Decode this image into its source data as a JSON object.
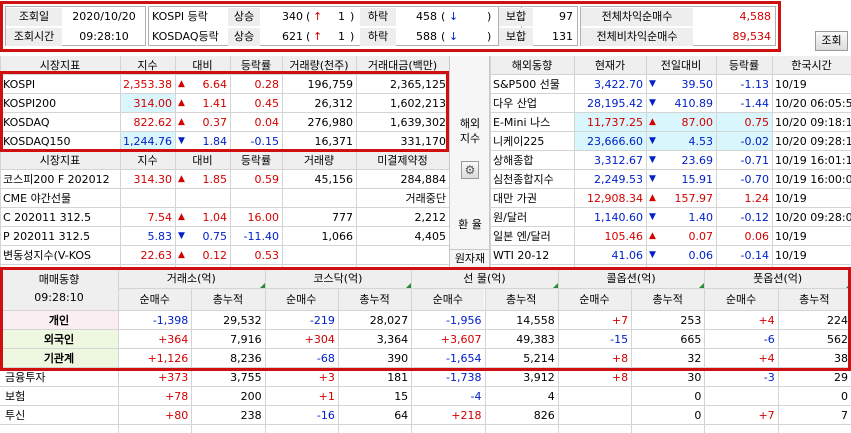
{
  "top": {
    "date_label": "조회일",
    "date_value": "2020/10/20",
    "time_label": "조회시간",
    "time_value": "09:28:10",
    "kospi_label": "KOSPI 등락",
    "kosdaq_label": "KOSDAQ등락",
    "rise_label": "상승",
    "fall_label": "하락",
    "flat_label": "보합",
    "kospi_rise": "340",
    "kospi_limit_up": "1",
    "kospi_fall": "458",
    "kospi_limit_down": "",
    "kospi_flat": "97",
    "kosdaq_rise": "621",
    "kosdaq_limit_up": "1",
    "kosdaq_fall": "588",
    "kosdaq_limit_down": "",
    "kosdaq_flat": "131",
    "arb_label": "전체차익순매수",
    "arb_value": "4,588",
    "nonarb_label": "전체비차익순매수",
    "nonarb_value": "89,534",
    "up_arrow": "↑",
    "down_arrow": "↓",
    "lookup_button": "조회"
  },
  "market": {
    "headers": [
      "시장지표",
      "지수",
      "대비",
      "등락률",
      "거래량(천주)",
      "거래대금(백만)"
    ],
    "rows": [
      {
        "name": "KOSPI",
        "index": "2,353.38",
        "dir": "up",
        "change": "6.64",
        "rate": "0.28",
        "volume": "196,759",
        "amount": "2,365,125"
      },
      {
        "name": "KOSPI200",
        "index": "314.00",
        "dir": "up",
        "change": "1.41",
        "rate": "0.45",
        "volume": "26,312",
        "amount": "1,602,213"
      },
      {
        "name": "KOSDAQ",
        "index": "822.62",
        "dir": "up",
        "change": "0.37",
        "rate": "0.04",
        "volume": "276,980",
        "amount": "1,639,302"
      },
      {
        "name": "KOSDAQ150",
        "index": "1,244.76",
        "dir": "down",
        "change": "1.84",
        "rate": "-0.15",
        "volume": "16,371",
        "amount": "331,170"
      }
    ]
  },
  "futures": {
    "headers": [
      "시장지표",
      "지수",
      "대비",
      "등락률",
      "거래량",
      "미결제약정"
    ],
    "rows": [
      {
        "name": "코스피200 F 202012",
        "index": "314.30",
        "dir": "up",
        "change": "1.85",
        "rate": "0.59",
        "volume": "45,156",
        "oi": "284,884"
      },
      {
        "name": "CME 야간선물",
        "index": "",
        "dir": "",
        "change": "",
        "rate": "",
        "volume": "",
        "oi": "거래중단"
      },
      {
        "name": "C 202011 312.5",
        "index": "7.54",
        "dir": "up",
        "change": "1.04",
        "rate": "16.00",
        "volume": "777",
        "oi": "2,212"
      },
      {
        "name": "P 202011 312.5",
        "index": "5.83",
        "dir": "down",
        "change": "0.75",
        "rate": "-11.40",
        "volume": "1,066",
        "oi": "4,405"
      },
      {
        "name": "변동성지수(V-KOS",
        "index": "22.63",
        "dir": "up",
        "change": "0.12",
        "rate": "0.53",
        "volume": "",
        "oi": ""
      }
    ]
  },
  "side": {
    "overseas_label": "해외\n지수",
    "gear_icon": "⚙",
    "fx_label": "환 율",
    "commodity_label": "원자재"
  },
  "overseas": {
    "headers": [
      "해외동향",
      "현재가",
      "전일대비",
      "등락률",
      "한국시간"
    ],
    "rows": [
      {
        "name": "S&P500 선물",
        "price": "3,422.70",
        "dir": "down",
        "change": "39.50",
        "rate": "-1.13",
        "time": "10/19",
        "hl": false
      },
      {
        "name": "다우 산업",
        "price": "28,195.42",
        "dir": "down",
        "change": "410.89",
        "rate": "-1.44",
        "time": "10/20 06:05:52",
        "hl": false
      },
      {
        "name": "E-Mini 나스",
        "price": "11,737.25",
        "dir": "up",
        "change": "87.00",
        "rate": "0.75",
        "time": "10/20 09:18:15",
        "hl": true
      },
      {
        "name": "니케이225",
        "price": "23,666.60",
        "dir": "down",
        "change": "4.53",
        "rate": "-0.02",
        "time": "10/20 09:28:15",
        "hl": true
      },
      {
        "name": "상해종합",
        "price": "3,312.67",
        "dir": "down",
        "change": "23.69",
        "rate": "-0.71",
        "time": "10/19 16:01:10",
        "hl": false
      },
      {
        "name": "심천종합지수",
        "price": "2,249.53",
        "dir": "down",
        "change": "15.91",
        "rate": "-0.70",
        "time": "10/19 16:00:03",
        "hl": false
      },
      {
        "name": "대만 가권",
        "price": "12,908.34",
        "dir": "up",
        "change": "157.97",
        "rate": "1.24",
        "time": "10/19",
        "hl": false
      },
      {
        "name": "원/달러",
        "price": "1,140.60",
        "dir": "down",
        "change": "1.40",
        "rate": "-0.12",
        "time": "10/20 09:28:09",
        "hl": false
      },
      {
        "name": "일본 엔/달러",
        "price": "105.46",
        "dir": "up",
        "change": "0.07",
        "rate": "0.06",
        "time": "10/19",
        "hl": false
      },
      {
        "name": "WTI 20-12",
        "price": "41.06",
        "dir": "down",
        "change": "0.06",
        "rate": "-0.14",
        "time": "10/19",
        "hl": false
      }
    ]
  },
  "investor": {
    "title": "매매동향",
    "time": "09:28:10",
    "groups": [
      "거래소(억)",
      "코스닥(억)",
      "선    물(억)",
      "콜옵션(억)",
      "풋옵션(억)"
    ],
    "sub": [
      "순매수",
      "총누적"
    ],
    "rows": [
      {
        "name": "개인",
        "bold": true,
        "vals": [
          "-1,398",
          "29,532",
          "-219",
          "28,027",
          "-1,956",
          "14,558",
          "+7",
          "253",
          "+4",
          "224"
        ]
      },
      {
        "name": "외국인",
        "bold": true,
        "vals": [
          "+364",
          "7,916",
          "+304",
          "3,364",
          "+3,607",
          "49,383",
          "-15",
          "665",
          "-6",
          "562"
        ]
      },
      {
        "name": "기관계",
        "bold": true,
        "vals": [
          "+1,126",
          "8,236",
          "-68",
          "390",
          "-1,654",
          "5,214",
          "+8",
          "32",
          "+4",
          "38"
        ]
      },
      {
        "name": "금융투자",
        "bold": false,
        "vals": [
          "+373",
          "3,755",
          "+3",
          "181",
          "-1,738",
          "3,912",
          "+8",
          "30",
          "-3",
          "29"
        ]
      },
      {
        "name": "보험",
        "bold": false,
        "vals": [
          "+78",
          "200",
          "+1",
          "15",
          "-4",
          "4",
          "",
          "0",
          "",
          "0"
        ]
      },
      {
        "name": "투신",
        "bold": false,
        "vals": [
          "+80",
          "238",
          "-16",
          "64",
          "+218",
          "826",
          "",
          "0",
          "+7",
          "7"
        ]
      }
    ]
  },
  "colors": {
    "up": "#d40000",
    "down": "#0020c8",
    "highlight": "#d01010",
    "cyan": "#d8f6fb",
    "pink": "#fbeef2",
    "green": "#eef7e0"
  }
}
